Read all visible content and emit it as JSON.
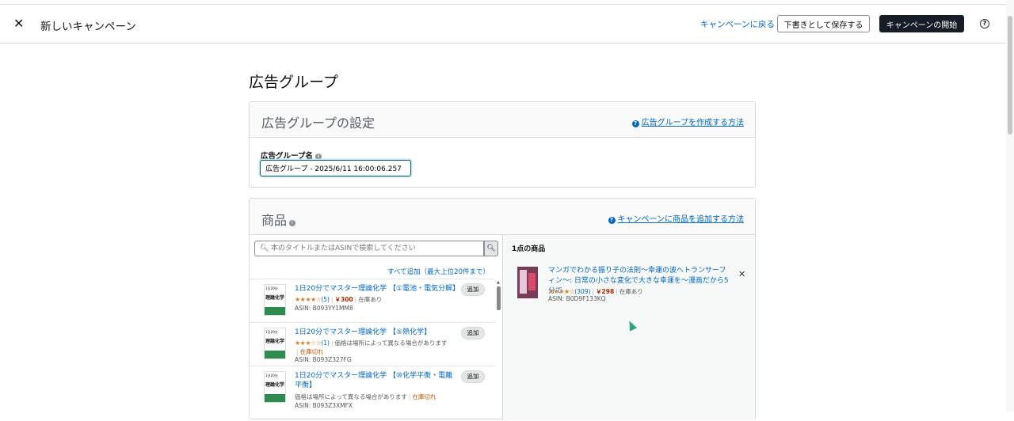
{
  "header": {
    "title": "新しいキャンペーン",
    "back_link": "キャンペーンに戻る",
    "save_draft": "下書きとして保存する",
    "start_campaign": "キャンペーンの開始",
    "help": "?"
  },
  "section_title": "広告グループ",
  "ad_group_settings": {
    "title": "広告グループの設定",
    "howto": "広告グループを作成する方法",
    "name_label": "広告グループ名",
    "name_value": "広告グループ - 2025/6/11 16:00:06.257"
  },
  "products": {
    "title": "商品",
    "howto": "キャンペーンに商品を追加する方法",
    "search_placeholder": "本のタイトルまたはASINで検索してください",
    "add_all": "すべて追加（最大上位20件まで）",
    "add_label": "追加",
    "items": [
      {
        "title": "1日20分でマスター理論化学 【①電池・電気分解】",
        "stars": "★★★★☆",
        "count": "(5)",
        "price": "￥300",
        "stock": "在庫あり",
        "asin": "ASIN: B093YY1MM8"
      },
      {
        "title": "1日20分でマスター理論化学 【⑤熱化学】",
        "stars": "★★★☆☆",
        "count": "(1)",
        "note": "価格は場所によって異なる場合があります",
        "stock": "在庫切れ",
        "asin": "ASIN: B093Z327FG"
      },
      {
        "title": "1日20分でマスター理論化学 【⑩化学平衡・電離平衡】",
        "note": "価格は場所によって異なる場合があります",
        "stock": "在庫切れ",
        "asin": "ASIN: B093Z3XMFX"
      }
    ],
    "thumb_text_small": "1日20分",
    "thumb_text_main": "理論化学"
  },
  "selected": {
    "count_label": "1点の商品",
    "item": {
      "title": "マンガでわかる振り子の法則〜幸運の波へトランサーフィン〜: 日常の小さな変化で大きな幸運を〜漫画だから5分で",
      "stars": "★★★★☆",
      "count": "(309)",
      "price": "￥298",
      "stock": "在庫あり",
      "asin": "ASIN: B0D9F133KQ"
    }
  },
  "colors": {
    "link": "#0066c0",
    "primary_button": "#161d26",
    "price": "#b12704",
    "star": "#de7921"
  }
}
